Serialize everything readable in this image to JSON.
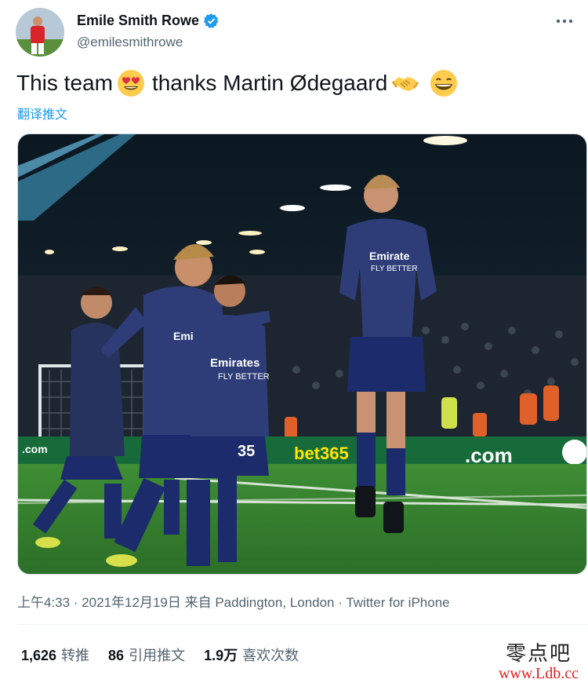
{
  "author": {
    "display_name": "Emile Smith Rowe",
    "handle": "@emilesmithrowe",
    "avatar_icon": "player-avatar",
    "verified_icon": "verified-badge-icon"
  },
  "tweet": {
    "text_part1": "This team",
    "text_part2": "thanks Martin Ødegaard",
    "emojis": [
      "heart-eyes-emoji",
      "handshake-emoji",
      "grinning-emoji"
    ],
    "translate_label": "翻译推文"
  },
  "media": {
    "description_icon": "photo-arsenal-players-celebrating"
  },
  "meta": {
    "time": "上午4:33",
    "date": "2021年12月19日",
    "location": "来自 Paddington, London",
    "source": "Twitter for iPhone"
  },
  "stats": {
    "retweets_count": "1,626",
    "retweets_label": "转推",
    "quotes_count": "86",
    "quotes_label": "引用推文",
    "likes_count": "1.9万",
    "likes_label": "喜欢次数"
  },
  "watermark": {
    "top": "零点吧",
    "bottom": "www.Ldb.cc"
  },
  "colors": {
    "accent": "#1d9bf0",
    "secondary_text": "#536471",
    "primary_text": "#0f1419"
  }
}
